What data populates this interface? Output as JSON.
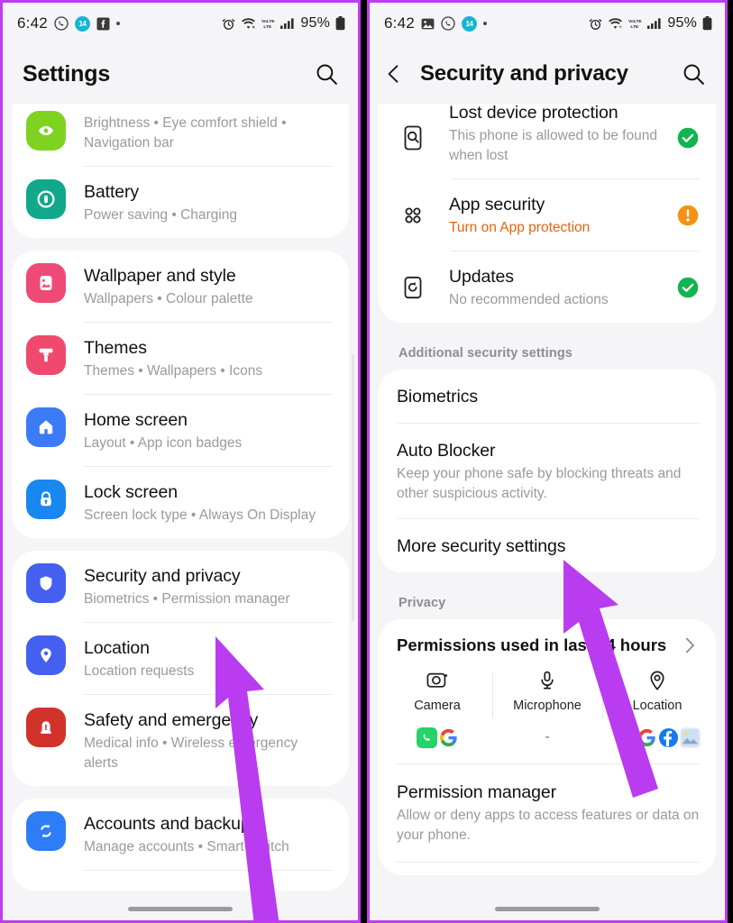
{
  "meta": {
    "accent_purple": "#c03cf0",
    "arrow_color": "#b93cf0",
    "bg": "#f5f5f7",
    "card_bg": "#ffffff",
    "warn_orange": "#e8630a",
    "ok_green": "#12b450",
    "alert_orange": "#f59215"
  },
  "left": {
    "statusbar": {
      "time": "6:42",
      "badge_text": "14",
      "battery_percent": "95%",
      "icons_left": [
        "whatsapp-icon",
        "badge-14-icon",
        "facebook-icon",
        "dot-icon"
      ],
      "icons_right": [
        "alarm-icon",
        "wifi-icon",
        "volte-icon",
        "signal-icon",
        "battery-icon"
      ]
    },
    "appbar": {
      "title": "Settings",
      "search": "search-icon"
    },
    "groups": [
      {
        "clipped_top": true,
        "items": [
          {
            "title": "",
            "subtitle": "Brightness  •  Eye comfort shield  •\nNavigation bar",
            "icon": "display-icon",
            "icon_color": "#7ed321"
          },
          {
            "title": "Battery",
            "subtitle": "Power saving  •  Charging",
            "icon": "battery-icon",
            "icon_color": "#12a88a"
          }
        ]
      },
      {
        "clipped_top": false,
        "items": [
          {
            "title": "Wallpaper and style",
            "subtitle": "Wallpapers  •  Colour palette",
            "icon": "wallpaper-icon",
            "icon_color": "#ef4a76"
          },
          {
            "title": "Themes",
            "subtitle": "Themes  •  Wallpapers  •  Icons",
            "icon": "themes-icon",
            "icon_color": "#ef4a6e"
          },
          {
            "title": "Home screen",
            "subtitle": "Layout  •  App icon badges",
            "icon": "home-icon",
            "icon_color": "#3b7bf6"
          },
          {
            "title": "Lock screen",
            "subtitle": "Screen lock type  •  Always On Display",
            "icon": "lock-icon",
            "icon_color": "#1987f0"
          }
        ]
      },
      {
        "clipped_top": false,
        "items": [
          {
            "title": "Security and privacy",
            "subtitle": "Biometrics  •  Permission manager",
            "icon": "shield-icon",
            "icon_color": "#4560f0"
          },
          {
            "title": "Location",
            "subtitle": "Location requests",
            "icon": "location-pin-icon",
            "icon_color": "#4560f0"
          },
          {
            "title": "Safety and emergency",
            "subtitle": "Medical info  •  Wireless emergency alerts",
            "icon": "emergency-icon",
            "icon_color": "#d1332b"
          }
        ]
      },
      {
        "clipped_top": false,
        "items": [
          {
            "title": "Accounts and backup",
            "subtitle": "Manage accounts  •  Smart Switch",
            "icon": "sync-icon",
            "icon_color": "#2d7df6"
          }
        ]
      }
    ]
  },
  "right": {
    "statusbar": {
      "time": "6:42",
      "badge_text": "14",
      "battery_percent": "95%",
      "icons_left": [
        "gallery-icon",
        "whatsapp-icon",
        "badge-14-icon",
        "dot-icon"
      ],
      "icons_right": [
        "alarm-icon",
        "wifi-icon",
        "volte-icon",
        "signal-icon",
        "battery-icon"
      ]
    },
    "appbar": {
      "back": "back-arrow-icon",
      "title": "Security and privacy",
      "search": "search-icon"
    },
    "status_card": [
      {
        "title": "Lost device protection",
        "subtitle": "This phone is allowed to be found when lost",
        "icon": "find-device-icon",
        "status": "ok",
        "warn": false
      },
      {
        "title": "App security",
        "subtitle": "Turn on App protection",
        "icon": "app-grid-icon",
        "status": "alert",
        "warn": true
      },
      {
        "title": "Updates",
        "subtitle": "No recommended actions",
        "icon": "update-icon",
        "status": "ok",
        "warn": false
      }
    ],
    "additional_label": "Additional security settings",
    "additional_items": [
      {
        "title": "Biometrics",
        "subtitle": ""
      },
      {
        "title": "Auto Blocker",
        "subtitle": "Keep your phone safe by blocking threats and other suspicious activity."
      },
      {
        "title": "More security settings",
        "subtitle": ""
      }
    ],
    "privacy_label": "Privacy",
    "permissions": {
      "heading": "Permissions used in last 24 hours",
      "chevron": "chevron-right-icon",
      "columns": [
        {
          "label": "Camera",
          "icon": "camera-icon",
          "apps": [
            "whatsapp-app-icon",
            "google-app-icon"
          ],
          "empty": false
        },
        {
          "label": "Microphone",
          "icon": "microphone-icon",
          "apps": [],
          "empty": true,
          "empty_text": "-"
        },
        {
          "label": "Location",
          "icon": "location-icon",
          "apps": [
            "muslimpro-app-icon",
            "google-app-icon",
            "facebook-app-icon",
            "photos-app-icon"
          ],
          "empty": false
        }
      ]
    },
    "permission_manager": {
      "title": "Permission manager",
      "subtitle": "Allow or deny apps to access features or data on your phone."
    }
  }
}
